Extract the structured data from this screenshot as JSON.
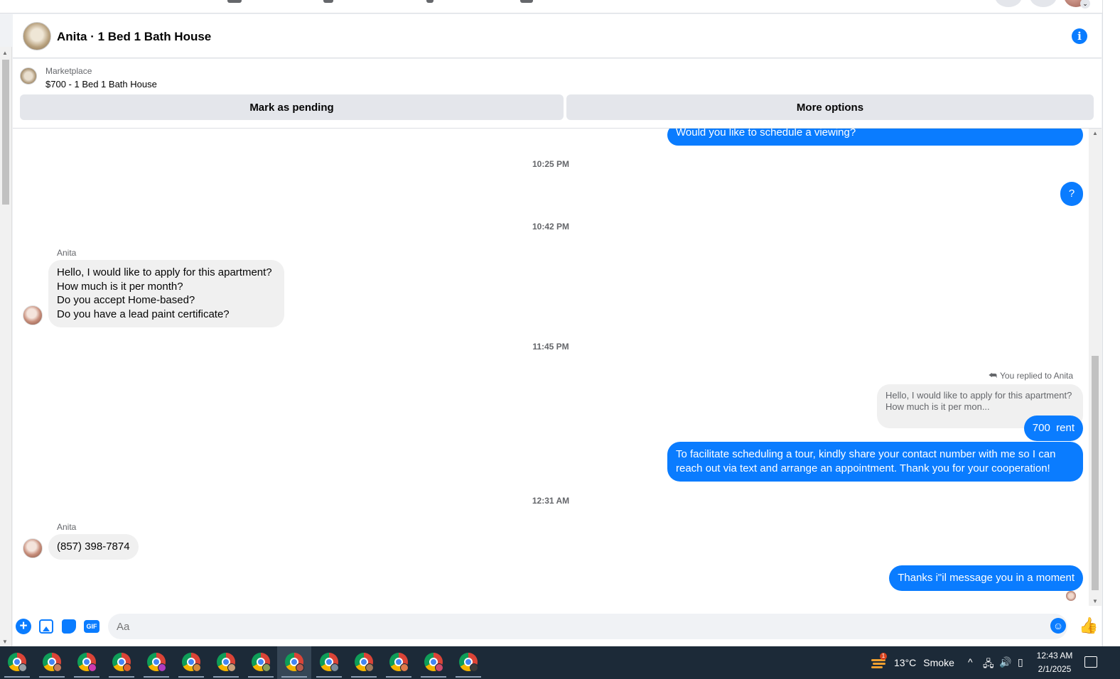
{
  "chat": {
    "title": "Anita · 1 Bed 1 Bath House"
  },
  "marketplace": {
    "label": "Marketplace",
    "listing": "$700 - 1 Bed 1 Bath House",
    "mark_pending_label": "Mark as pending",
    "more_options_label": "More options"
  },
  "messages": {
    "out_top": "Would you like to schedule a viewing?",
    "ts1": "10:25 PM",
    "out_q": "?",
    "ts2": "10:42 PM",
    "sender1": "Anita",
    "in1_lines": [
      "Hello, I would like to apply for this apartment?",
      "How much is it per month?",
      "Do you accept Home-based?",
      "Do you have a lead paint certificate?"
    ],
    "ts3": "11:45 PM",
    "reply_note": "You replied to Anita",
    "quoted_line1": "Hello, I would like to apply for this apartment?",
    "quoted_line2": "How much is it per mon...",
    "out_rent": "700  rent",
    "out_tour_line1": "To facilitate scheduling a tour, kindly share your contact number with me so I can",
    "out_tour_line2": "reach out via text and arrange an appointment. Thank you for your cooperation!",
    "ts4": "12:31 AM",
    "sender2": "Anita",
    "in_phone": "(857) 398-7874",
    "out_thanks": "Thanks i\"il message you in a moment"
  },
  "composer": {
    "placeholder": "Aa",
    "gif_label": "GIF"
  },
  "taskbar": {
    "weather_temp": "13°C",
    "weather_desc": "Smoke",
    "weather_badge": "1",
    "time": "12:43 AM",
    "date": "2/1/2025"
  },
  "icons": {
    "info": "info-icon",
    "plus": "plus-circle-icon",
    "photo": "photo-icon",
    "sticker": "sticker-icon",
    "gif": "gif-icon",
    "emoji": "emoji-icon",
    "like": "thumbs-up-icon",
    "reply": "reply-arrow-icon"
  },
  "colors": {
    "accent": "#0a7cff",
    "bubble_in": "#f0f0f0",
    "taskbar": "#1c2a38"
  }
}
